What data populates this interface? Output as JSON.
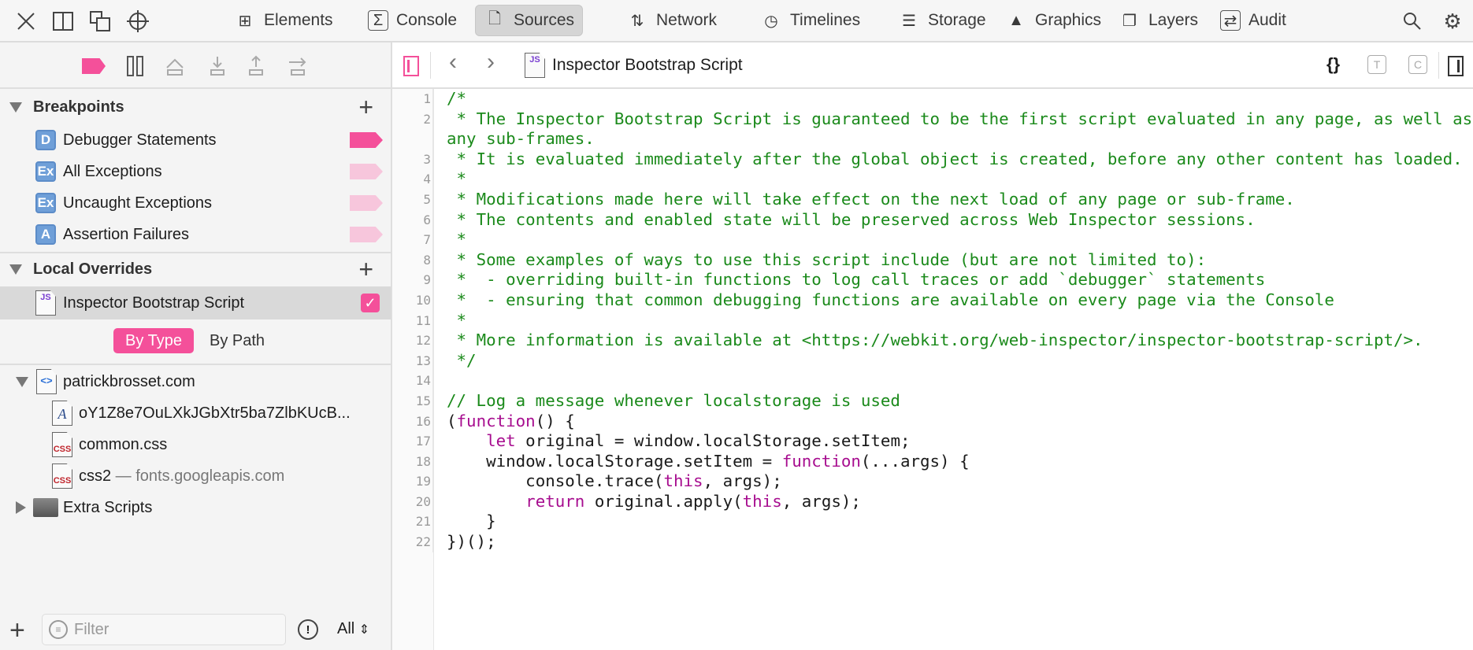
{
  "toolbar": {
    "tabs": [
      {
        "label": "Elements",
        "icon": "elements-icon"
      },
      {
        "label": "Console",
        "icon": "console-icon"
      },
      {
        "label": "Sources",
        "icon": "sources-icon",
        "active": true
      },
      {
        "label": "Network",
        "icon": "network-icon"
      },
      {
        "label": "Timelines",
        "icon": "timelines-icon"
      },
      {
        "label": "Storage",
        "icon": "storage-icon"
      },
      {
        "label": "Graphics",
        "icon": "graphics-icon"
      },
      {
        "label": "Layers",
        "icon": "layers-icon"
      },
      {
        "label": "Audit",
        "icon": "audit-icon"
      }
    ]
  },
  "sidebar": {
    "breakpoints": {
      "title": "Breakpoints",
      "items": [
        {
          "badge": "D",
          "label": "Debugger Statements",
          "active": true
        },
        {
          "badge": "Ex",
          "label": "All Exceptions",
          "active": false
        },
        {
          "badge": "Ex",
          "label": "Uncaught Exceptions",
          "active": false
        },
        {
          "badge": "A",
          "label": "Assertion Failures",
          "active": false
        }
      ]
    },
    "overrides": {
      "title": "Local Overrides",
      "items": [
        {
          "icon": "JS",
          "label": "Inspector Bootstrap Script",
          "checked": true
        }
      ]
    },
    "grouping": {
      "by_type": "By Type",
      "by_path": "By Path"
    },
    "tree": {
      "root": "patrickbrosset.com",
      "children": [
        {
          "icon": "A",
          "label": "oY1Z8e7OuLXkJGbXtr5ba7ZlbKUcB..."
        },
        {
          "icon": "CSS",
          "label": "common.css"
        },
        {
          "icon": "CSS",
          "label": "css2",
          "suffix": " — fonts.googleapis.com"
        }
      ],
      "folder": "Extra Scripts"
    },
    "filter": {
      "placeholder": "Filter",
      "scope": "All"
    }
  },
  "editor": {
    "title": "Inspector Bootstrap Script",
    "file_icon": "JS",
    "lines": [
      [
        [
          "comment",
          "/*"
        ]
      ],
      [
        [
          "comment",
          " * The Inspector Bootstrap Script is guaranteed to be the first script evaluated in any page, as well as any sub-frames."
        ]
      ],
      [
        [
          "comment",
          " * It is evaluated immediately after the global object is created, before any other content has loaded."
        ]
      ],
      [
        [
          "comment",
          " *"
        ]
      ],
      [
        [
          "comment",
          " * Modifications made here will take effect on the next load of any page or sub-frame."
        ]
      ],
      [
        [
          "comment",
          " * The contents and enabled state will be preserved across Web Inspector sessions."
        ]
      ],
      [
        [
          "comment",
          " *"
        ]
      ],
      [
        [
          "comment",
          " * Some examples of ways to use this script include (but are not limited to):"
        ]
      ],
      [
        [
          "comment",
          " *  - overriding built-in functions to log call traces or add `debugger` statements"
        ]
      ],
      [
        [
          "comment",
          " *  - ensuring that common debugging functions are available on every page via the Console"
        ]
      ],
      [
        [
          "comment",
          " *"
        ]
      ],
      [
        [
          "comment",
          " * More information is available at <https://webkit.org/web-inspector/inspector-bootstrap-script/>."
        ]
      ],
      [
        [
          "comment",
          " */"
        ]
      ],
      [
        [
          "plain",
          ""
        ]
      ],
      [
        [
          "comment",
          "// Log a message whenever localstorage is used"
        ]
      ],
      [
        [
          "plain",
          "("
        ],
        [
          "keyword",
          "function"
        ],
        [
          "plain",
          "() {"
        ]
      ],
      [
        [
          "plain",
          "    "
        ],
        [
          "keyword",
          "let"
        ],
        [
          "plain",
          " original = window.localStorage.setItem;"
        ]
      ],
      [
        [
          "plain",
          "    window.localStorage.setItem = "
        ],
        [
          "keyword",
          "function"
        ],
        [
          "plain",
          "(...args) {"
        ]
      ],
      [
        [
          "plain",
          "        console.trace("
        ],
        [
          "keyword",
          "this"
        ],
        [
          "plain",
          ", args);"
        ]
      ],
      [
        [
          "plain",
          "        "
        ],
        [
          "keyword",
          "return"
        ],
        [
          "plain",
          " original.apply("
        ],
        [
          "keyword",
          "this"
        ],
        [
          "plain",
          ", args);"
        ]
      ],
      [
        [
          "plain",
          "    }"
        ]
      ],
      [
        [
          "plain",
          "})();"
        ]
      ]
    ]
  },
  "colors": {
    "accent": "#f4509a",
    "accent_light": "#f7c6dc",
    "comment": "#1b8a1b",
    "keyword": "#a70d8f"
  }
}
